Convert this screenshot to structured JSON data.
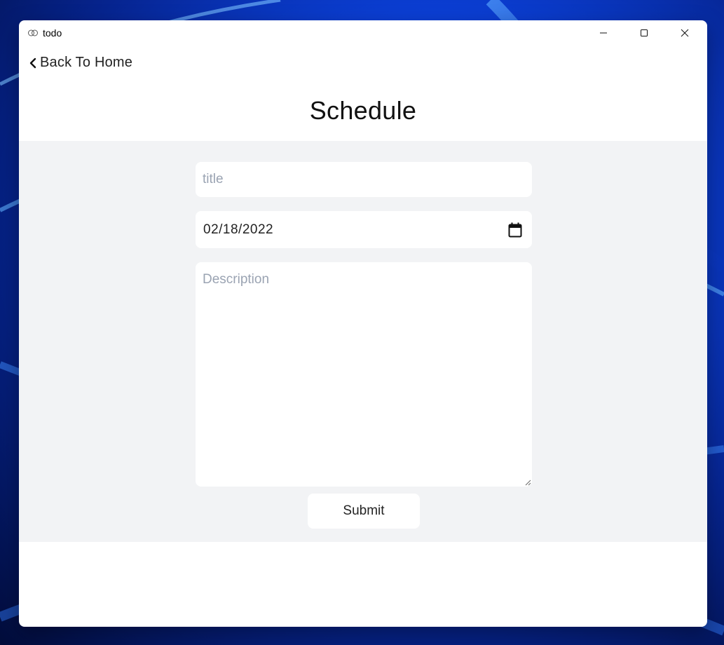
{
  "window": {
    "title": "todo",
    "controls": {
      "minimize": "minimize-icon",
      "maximize": "maximize-icon",
      "close": "close-icon"
    }
  },
  "nav": {
    "back_label": "Back To Home",
    "back_icon": "chevron-left-icon"
  },
  "page": {
    "title": "Schedule"
  },
  "form": {
    "title_placeholder": "title",
    "title_value": "",
    "date_value": "02/18/2022",
    "date_icon": "calendar-icon",
    "description_placeholder": "Description",
    "description_value": "",
    "submit_label": "Submit"
  },
  "colors": {
    "window_bg": "#ffffff",
    "form_area_bg": "#f2f3f5",
    "placeholder": "#9aa3b2",
    "text": "#222222"
  }
}
